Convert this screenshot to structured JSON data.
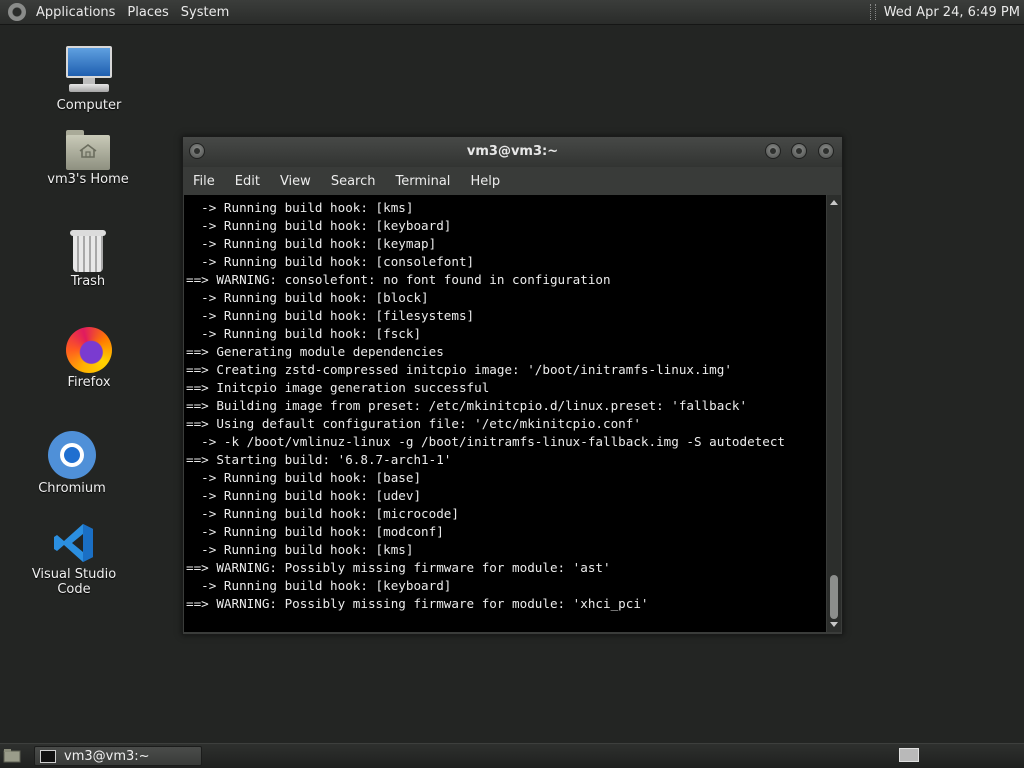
{
  "top_panel": {
    "menus": [
      "Applications",
      "Places",
      "System"
    ],
    "clock": "Wed Apr 24,  6:49 PM"
  },
  "desktop": {
    "icons": [
      {
        "label": "Computer",
        "icon": "computer-icon"
      },
      {
        "label": "vm3's Home",
        "icon": "home-folder-icon"
      },
      {
        "label": "Trash",
        "icon": "trash-icon"
      },
      {
        "label": "Firefox",
        "icon": "firefox-icon"
      },
      {
        "label": "Chromium",
        "icon": "chromium-icon"
      },
      {
        "label": "Visual Studio Code",
        "icon": "vscode-icon"
      }
    ]
  },
  "terminal": {
    "title": "vm3@vm3:~",
    "menu": [
      "File",
      "Edit",
      "View",
      "Search",
      "Terminal",
      "Help"
    ],
    "lines": [
      "  -> Running build hook: [kms]",
      "  -> Running build hook: [keyboard]",
      "  -> Running build hook: [keymap]",
      "  -> Running build hook: [consolefont]",
      "==> WARNING: consolefont: no font found in configuration",
      "  -> Running build hook: [block]",
      "  -> Running build hook: [filesystems]",
      "  -> Running build hook: [fsck]",
      "==> Generating module dependencies",
      "==> Creating zstd-compressed initcpio image: '/boot/initramfs-linux.img'",
      "==> Initcpio image generation successful",
      "==> Building image from preset: /etc/mkinitcpio.d/linux.preset: 'fallback'",
      "==> Using default configuration file: '/etc/mkinitcpio.conf'",
      "  -> -k /boot/vmlinuz-linux -g /boot/initramfs-linux-fallback.img -S autodetect",
      "==> Starting build: '6.8.7-arch1-1'",
      "  -> Running build hook: [base]",
      "  -> Running build hook: [udev]",
      "  -> Running build hook: [microcode]",
      "  -> Running build hook: [modconf]",
      "  -> Running build hook: [kms]",
      "==> WARNING: Possibly missing firmware for module: 'ast'",
      "  -> Running build hook: [keyboard]",
      "==> WARNING: Possibly missing firmware for module: 'xhci_pci'"
    ]
  },
  "taskbar": {
    "window_title": "vm3@vm3:~"
  }
}
